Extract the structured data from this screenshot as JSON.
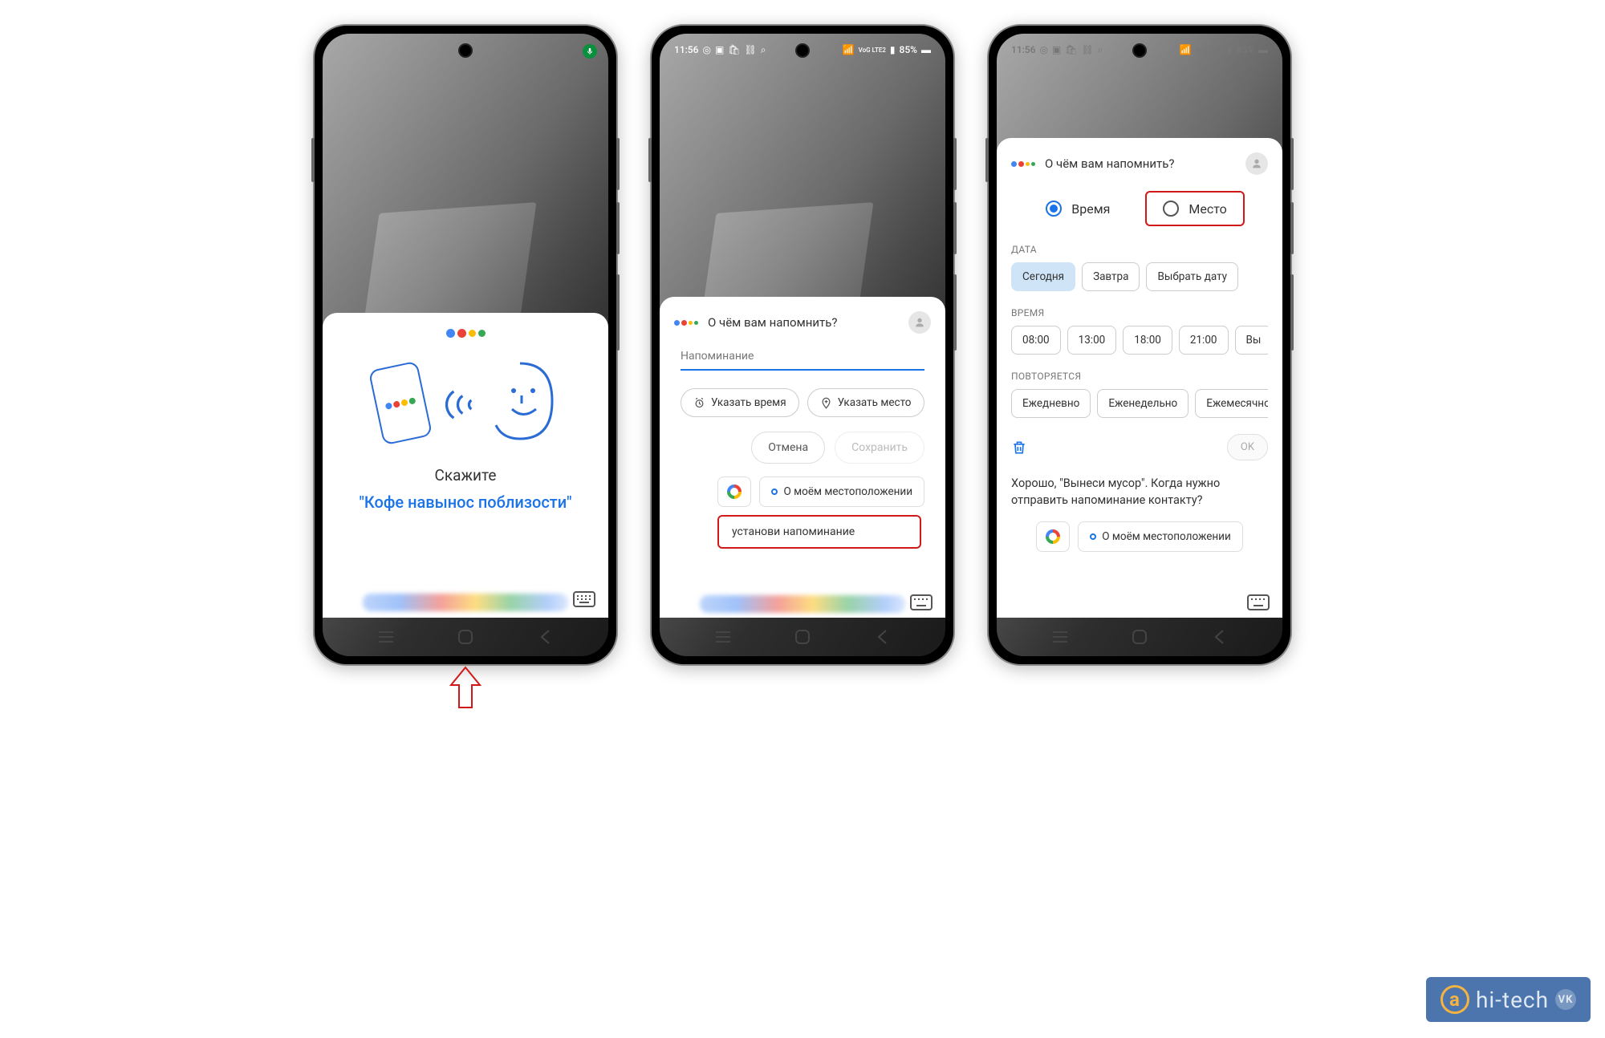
{
  "status": {
    "time": "11:56",
    "battery": "85%",
    "network": "VoG LTE2"
  },
  "phone1": {
    "say_label": "Скажите",
    "example": "\"Кофе навынос поблизости\""
  },
  "phone2": {
    "header_title": "О чём вам напомнить?",
    "input_label": "Напоминание",
    "chip_time": "Указать время",
    "chip_place": "Указать место",
    "btn_cancel": "Отмена",
    "btn_save": "Сохранить",
    "sugg_location": "О моём местоположении",
    "highlight": "установи напоминание"
  },
  "phone3": {
    "header_title": "О чём вам напомнить?",
    "radio_time": "Время",
    "radio_place": "Место",
    "section_date": "ДАТА",
    "date_options": [
      "Сегодня",
      "Завтра",
      "Выбрать дату"
    ],
    "section_time": "ВРЕМЯ",
    "time_options": [
      "08:00",
      "13:00",
      "18:00",
      "21:00",
      "Вы"
    ],
    "section_repeat": "ПОВТОРЯЕТСЯ",
    "repeat_options": [
      "Ежедневно",
      "Еженедельно",
      "Ежемесячно"
    ],
    "ok_label": "OK",
    "response": "Хорошо, \"Вынеси мусор\". Когда нужно отправить напоминание контакту?",
    "sugg_location": "О моём местоположении"
  },
  "watermark": {
    "text": "hi-tech",
    "vk": "VK"
  }
}
